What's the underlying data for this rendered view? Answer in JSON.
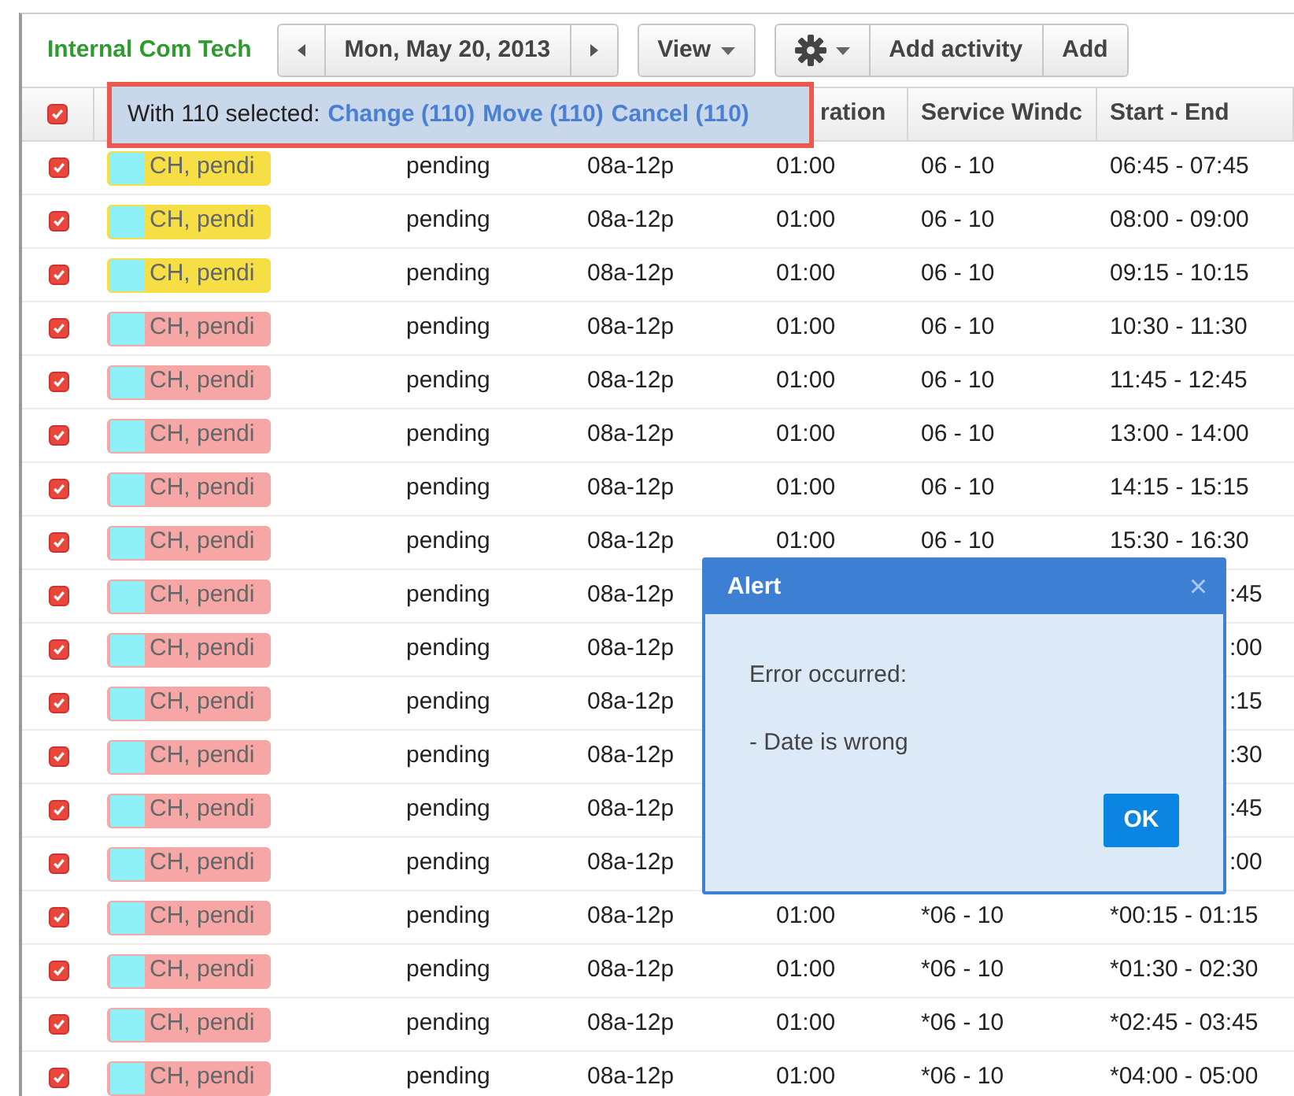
{
  "toolbar": {
    "title": "Internal Com Tech",
    "date": "Mon, May 20, 2013",
    "view_button": "View",
    "action_buttons": [
      "Add activity",
      "Add"
    ]
  },
  "table": {
    "header_checked": true,
    "columns": [
      "",
      "",
      "",
      "",
      "ration",
      "Service Windc",
      "Start - End"
    ],
    "rows": [
      {
        "checked": true,
        "color": "#f5df45",
        "name": "CH, pendi",
        "status": "pending",
        "time": "08a-12p",
        "duration": "01:00",
        "window": "06 - 10",
        "start_end": "06:45 - 07:45"
      },
      {
        "checked": true,
        "color": "#f5df45",
        "name": "CH, pendi",
        "status": "pending",
        "time": "08a-12p",
        "duration": "01:00",
        "window": "06 - 10",
        "start_end": "08:00 - 09:00"
      },
      {
        "checked": true,
        "color": "#f5df45",
        "name": "CH, pendi",
        "status": "pending",
        "time": "08a-12p",
        "duration": "01:00",
        "window": "06 - 10",
        "start_end": "09:15 - 10:15"
      },
      {
        "checked": true,
        "color": "#f7a6a6",
        "name": "CH, pendi",
        "status": "pending",
        "time": "08a-12p",
        "duration": "01:00",
        "window": "06 - 10",
        "start_end": "10:30 - 11:30"
      },
      {
        "checked": true,
        "color": "#f7a6a6",
        "name": "CH, pendi",
        "status": "pending",
        "time": "08a-12p",
        "duration": "01:00",
        "window": "06 - 10",
        "start_end": "11:45 - 12:45"
      },
      {
        "checked": true,
        "color": "#f7a6a6",
        "name": "CH, pendi",
        "status": "pending",
        "time": "08a-12p",
        "duration": "01:00",
        "window": "06 - 10",
        "start_end": "13:00 - 14:00"
      },
      {
        "checked": true,
        "color": "#f7a6a6",
        "name": "CH, pendi",
        "status": "pending",
        "time": "08a-12p",
        "duration": "01:00",
        "window": "06 - 10",
        "start_end": "14:15 - 15:15"
      },
      {
        "checked": true,
        "color": "#f7a6a6",
        "name": "CH, pendi",
        "status": "pending",
        "time": "08a-12p",
        "duration": "01:00",
        "window": "06 - 10",
        "start_end": "15:30 - 16:30"
      },
      {
        "checked": true,
        "color": "#f7a6a6",
        "name": "CH, pendi",
        "status": "pending",
        "time": "08a-12p",
        "start_end_tail": ":45"
      },
      {
        "checked": true,
        "color": "#f7a6a6",
        "name": "CH, pendi",
        "status": "pending",
        "time": "08a-12p",
        "start_end_tail": ":00"
      },
      {
        "checked": true,
        "color": "#f7a6a6",
        "name": "CH, pendi",
        "status": "pending",
        "time": "08a-12p",
        "start_end_tail": ":15"
      },
      {
        "checked": true,
        "color": "#f7a6a6",
        "name": "CH, pendi",
        "status": "pending",
        "time": "08a-12p",
        "start_end_tail": ":30"
      },
      {
        "checked": true,
        "color": "#f7a6a6",
        "name": "CH, pendi",
        "status": "pending",
        "time": "08a-12p",
        "start_end_tail": ":45"
      },
      {
        "checked": true,
        "color": "#f7a6a6",
        "name": "CH, pendi",
        "status": "pending",
        "time": "08a-12p",
        "start_end_tail": ":00"
      },
      {
        "checked": true,
        "color": "#f7a6a6",
        "name": "CH, pendi",
        "status": "pending",
        "time": "08a-12p",
        "duration": "01:00",
        "window": "*06 - 10",
        "start_end": "*00:15 - 01:15"
      },
      {
        "checked": true,
        "color": "#f7a6a6",
        "name": "CH, pendi",
        "status": "pending",
        "time": "08a-12p",
        "duration": "01:00",
        "window": "*06 - 10",
        "start_end": "*01:30 - 02:30"
      },
      {
        "checked": true,
        "color": "#f7a6a6",
        "name": "CH, pendi",
        "status": "pending",
        "time": "08a-12p",
        "duration": "01:00",
        "window": "*06 - 10",
        "start_end": "*02:45 - 03:45"
      },
      {
        "checked": true,
        "color": "#f7a6a6",
        "name": "CH, pendi",
        "status": "pending",
        "time": "08a-12p",
        "duration": "01:00",
        "window": "*06 - 10",
        "start_end": "*04:00 - 05:00"
      }
    ]
  },
  "selection_bar": {
    "text": "With 110 selected:",
    "links": [
      "Change (110)",
      "Move (110)",
      "Cancel (110)"
    ]
  },
  "alert": {
    "title": "Alert",
    "close": "×",
    "lines": [
      "Error occurred:",
      "- Date is wrong"
    ],
    "button": "OK"
  }
}
